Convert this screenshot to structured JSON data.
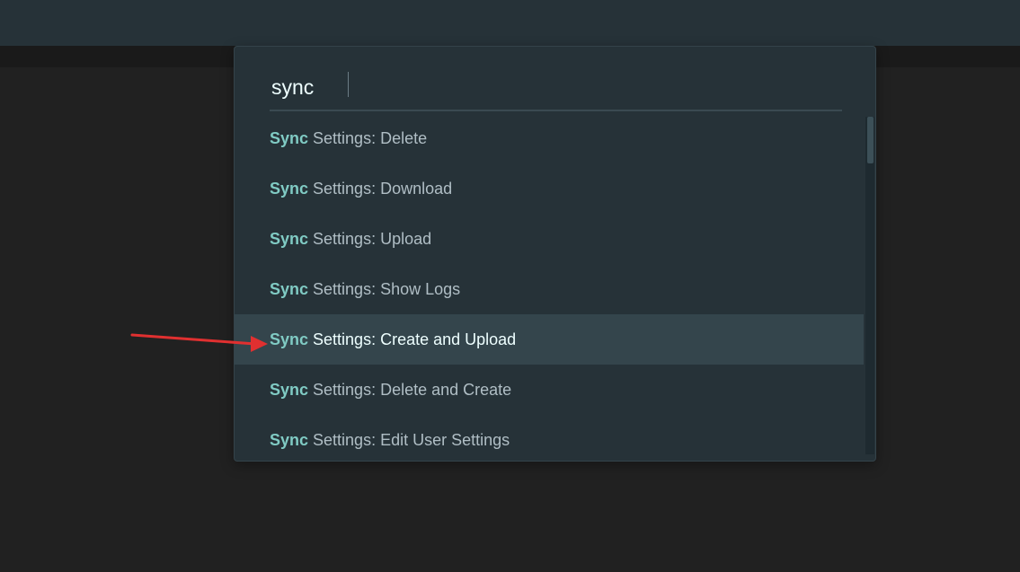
{
  "command_palette": {
    "search": {
      "value": "sync"
    },
    "results": [
      {
        "match": "Sync",
        "rest": " Settings: Delete"
      },
      {
        "match": "Sync",
        "rest": " Settings: Download"
      },
      {
        "match": "Sync",
        "rest": " Settings: Upload"
      },
      {
        "match": "Sync",
        "rest": " Settings: Show Logs"
      },
      {
        "match": "Sync",
        "rest": " Settings: Create and Upload"
      },
      {
        "match": "Sync",
        "rest": " Settings: Delete and Create"
      },
      {
        "match": "Sync",
        "rest": " Settings: Edit User Settings"
      }
    ],
    "selected_index": 4
  },
  "colors": {
    "match_highlight": "#80cbc4",
    "annotation_arrow": "#e03030"
  },
  "icons": {
    "annotation": "red-arrow-icon"
  }
}
